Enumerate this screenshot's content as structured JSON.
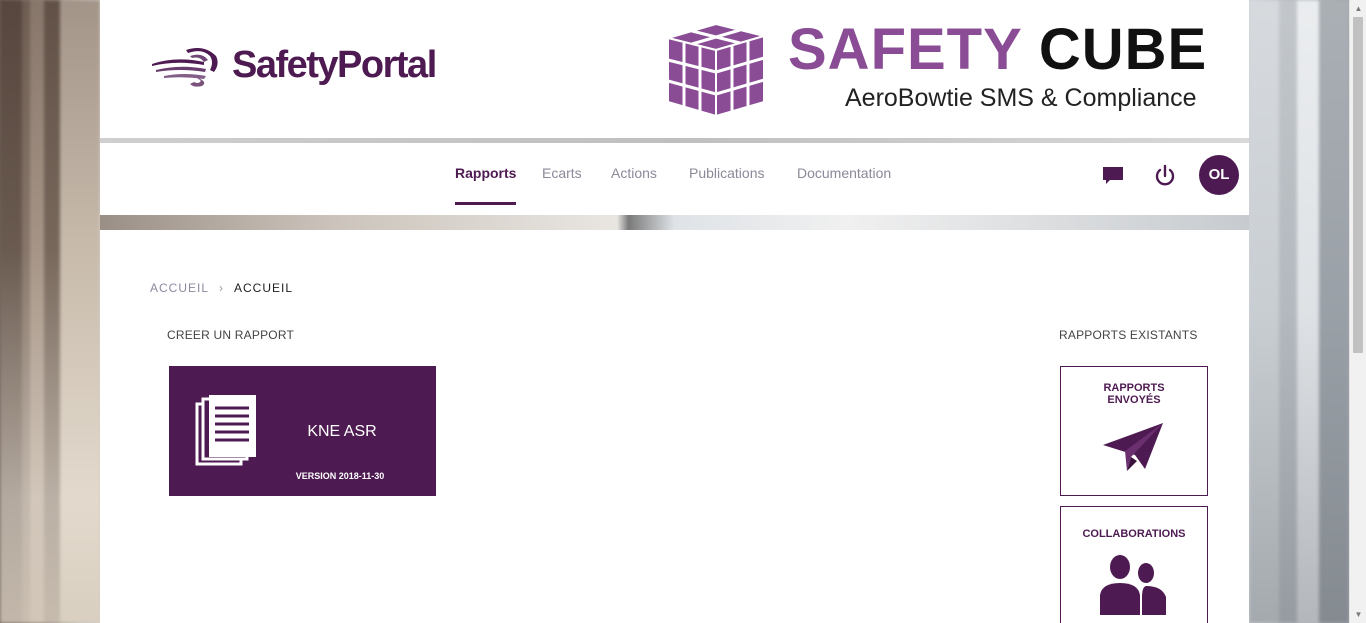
{
  "brand": {
    "left_logo_text": "SafetyPortal",
    "right_logo_title_part1": "SAFETY",
    "right_logo_title_part2": "CUBE",
    "right_logo_subtitle": "AeroBowtie SMS & Compliance",
    "accent_color": "#4e1a52",
    "light_accent": "#8a4d95"
  },
  "nav": {
    "items": [
      {
        "label": "Rapports",
        "active": true
      },
      {
        "label": "Ecarts",
        "active": false
      },
      {
        "label": "Actions",
        "active": false
      },
      {
        "label": "Publications",
        "active": false
      },
      {
        "label": "Documentation",
        "active": false
      }
    ],
    "icons": [
      "chat-icon",
      "power-icon"
    ],
    "avatar_initials": "OL"
  },
  "breadcrumb": {
    "items": [
      "ACCUEIL",
      "ACCUEIL"
    ]
  },
  "create_section": {
    "title": "CREER UN RAPPORT",
    "card": {
      "name": "KNE ASR",
      "version": "VERSION 2018-11-30",
      "icon": "document-stack-icon"
    }
  },
  "existing_section": {
    "title": "RAPPORTS EXISTANTS",
    "cards": [
      {
        "line1": "RAPPORTS",
        "line2": "ENVOYÉS",
        "icon": "paper-plane-icon"
      },
      {
        "line1": "COLLABORATIONS",
        "icon": "users-icon"
      }
    ]
  }
}
